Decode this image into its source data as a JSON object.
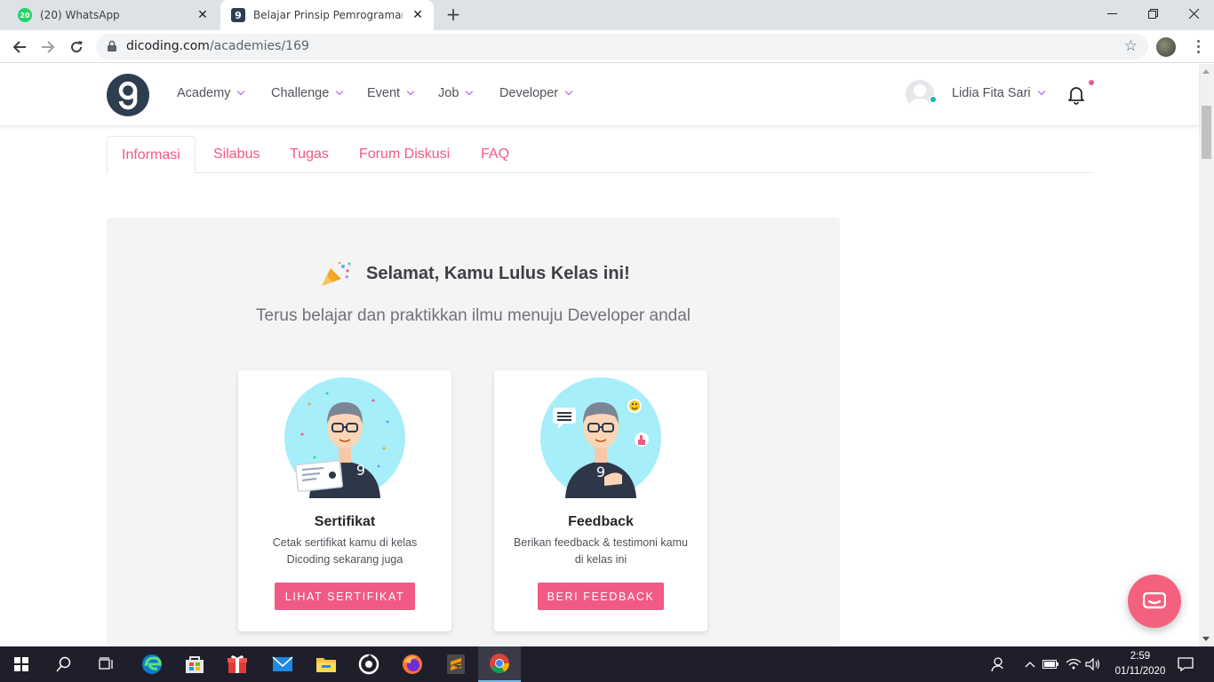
{
  "browser": {
    "tabs": [
      {
        "title": "(20) WhatsApp",
        "badge": "20",
        "icon": "whatsapp-icon",
        "active": false
      },
      {
        "title": "Belajar Prinsip Pemrograman SOLID",
        "badge": "9",
        "icon": "dicoding-icon",
        "active": true
      }
    ],
    "url_host": "dicoding.com",
    "url_path": "/academies/169"
  },
  "header": {
    "nav": [
      {
        "label": "Academy"
      },
      {
        "label": "Challenge"
      },
      {
        "label": "Event"
      },
      {
        "label": "Job"
      },
      {
        "label": "Developer"
      }
    ],
    "user_name": "Lidia Fita Sari"
  },
  "tabs": [
    "Informasi",
    "Silabus",
    "Tugas",
    "Forum Diskusi",
    "FAQ"
  ],
  "graduation": {
    "title": "Selamat, Kamu Lulus Kelas ini!",
    "subtitle": "Terus belajar dan praktikkan ilmu menuju Developer andal",
    "cards": [
      {
        "title": "Sertifikat",
        "desc_line1": "Cetak sertifikat kamu di kelas",
        "desc_line2": "Dicoding sekarang juga",
        "button": "LIHAT SERTIFIKAT"
      },
      {
        "title": "Feedback",
        "desc_line1": "Berikan feedback & testimoni kamu",
        "desc_line2": "di kelas ini",
        "button": "BERI FEEDBACK"
      }
    ]
  },
  "taskbar": {
    "time": "2:59",
    "date": "01/11/2020"
  },
  "colors": {
    "accent": "#f05a84",
    "caret": "#a855f7",
    "brand_dark": "#2d3e50",
    "illustration_bg": "#a5eefa"
  }
}
